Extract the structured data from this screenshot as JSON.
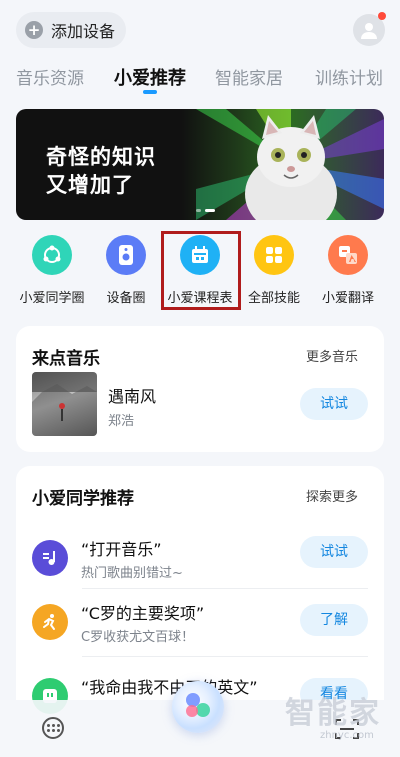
{
  "header": {
    "add_device_label": "添加设备",
    "tabs": [
      {
        "label": "音乐资源",
        "active": false
      },
      {
        "label": "小爱推荐",
        "active": true
      },
      {
        "label": "智能家居",
        "active": false
      },
      {
        "label": "训练计划",
        "active": false
      }
    ]
  },
  "banner": {
    "line1": "奇怪的知识",
    "line2": "又增加了"
  },
  "shortcuts": [
    {
      "label": "小爱同学圈",
      "icon": "share-circle-icon",
      "color": "#2fd5b8"
    },
    {
      "label": "设备圈",
      "icon": "speaker-icon",
      "color": "#5b7cf6"
    },
    {
      "label": "小爱课程表",
      "icon": "calendar-icon",
      "color": "#1fb1f5",
      "highlighted": true
    },
    {
      "label": "全部技能",
      "icon": "grid-icon",
      "color": "#ffc512"
    },
    {
      "label": "小爱翻译",
      "icon": "translate-icon",
      "color": "#ff7a4d"
    }
  ],
  "music_card": {
    "title": "来点音乐",
    "more_label": "更多音乐",
    "song": {
      "title": "遇南风",
      "artist": "郑浩",
      "action_label": "试试"
    }
  },
  "recommend_card": {
    "title": "小爱同学推荐",
    "more_label": "探索更多",
    "items": [
      {
        "title": "“打开音乐”",
        "subtitle": "热门歌曲别错过~",
        "action_label": "试试",
        "icon": "music-note-icon",
        "color": "#5a4dd8"
      },
      {
        "title": "“C罗的主要奖项”",
        "subtitle": "C罗收获尤文百球！",
        "action_label": "了解",
        "icon": "runner-icon",
        "color": "#f5a623"
      },
      {
        "title": "“我命由我不由天的英文”",
        "subtitle": "",
        "action_label": "看看",
        "icon": "outlet-icon",
        "color": "#2ecc71"
      }
    ]
  },
  "watermark": {
    "text": "智能家",
    "url": "zhnyc.com"
  },
  "colors": {
    "accent": "#1a9aff",
    "highlight_border": "#b01c1c",
    "pill_bg": "#e6f3fd",
    "pill_text": "#1487e0"
  }
}
